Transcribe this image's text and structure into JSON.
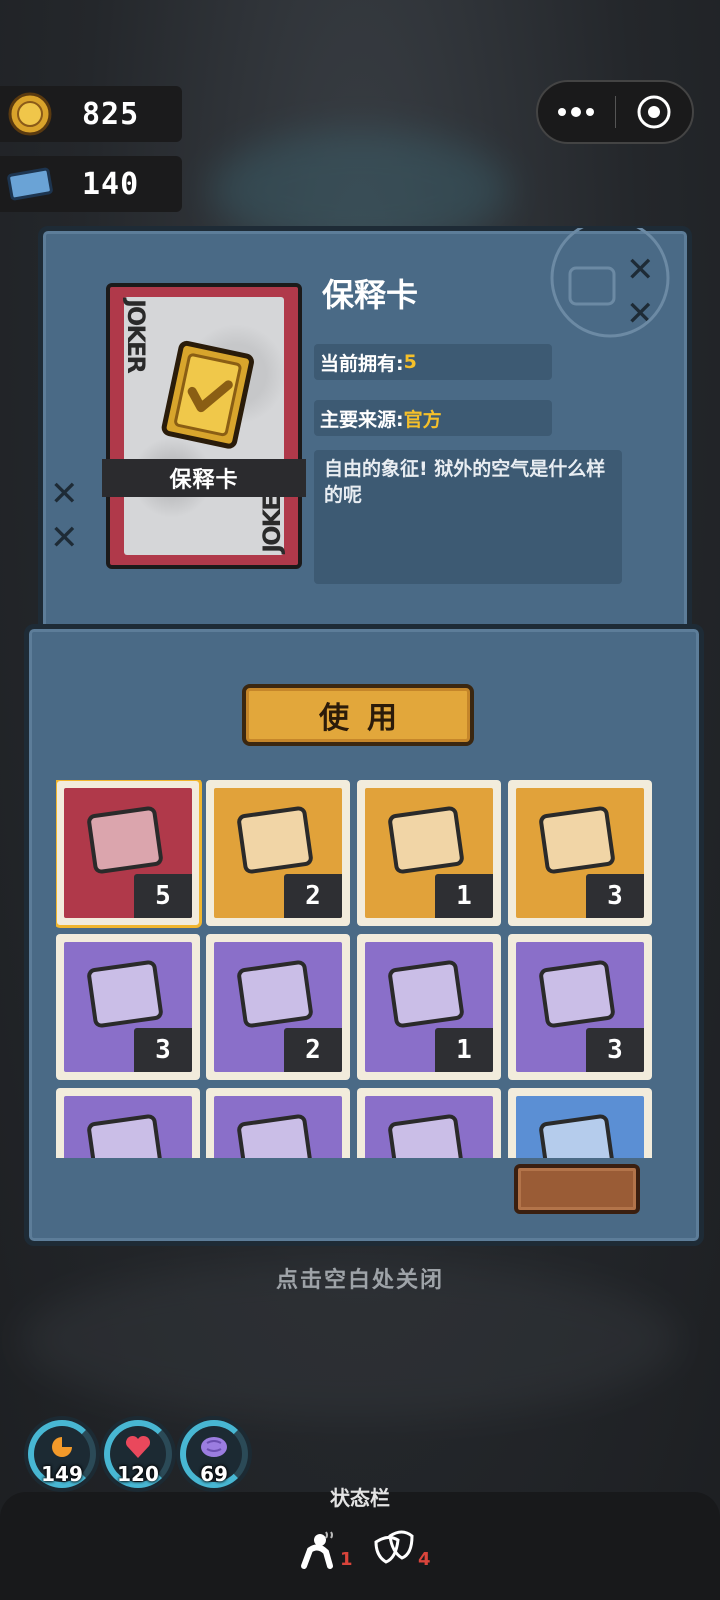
{
  "currency": {
    "coins": "825",
    "tickets": "140",
    "coin_icon": "gold-coin-icon",
    "ticket_icon": "blue-ticket-icon"
  },
  "capsule": {
    "more_icon": "more-dots-icon",
    "close_icon": "target-circle-icon"
  },
  "detail": {
    "title": "保释卡",
    "card_label": "保释卡",
    "card_corner_text": "JOKER",
    "owned_label": "当前拥有:",
    "owned_value": "5",
    "source_label": "主要来源:",
    "source_value": "官方",
    "description": "自由的象征! 狱外的空气是什么样的呢"
  },
  "use_button": {
    "label": "使用"
  },
  "items": [
    {
      "name": "bail-card",
      "count": "5",
      "bg": "#b0394a",
      "selected": true
    },
    {
      "name": "paw-map",
      "count": "2",
      "bg": "#e1a23a"
    },
    {
      "name": "film-reel",
      "count": "1",
      "bg": "#e1a23a"
    },
    {
      "name": "medical-card",
      "count": "3",
      "bg": "#e1a23a"
    },
    {
      "name": "blue-ticket",
      "count": "3",
      "bg": "#8a6fc9"
    },
    {
      "name": "id-card",
      "count": "2",
      "bg": "#8a6fc9"
    },
    {
      "name": "first-aid-kit",
      "count": "1",
      "bg": "#8a6fc9"
    },
    {
      "name": "green-book",
      "count": "3",
      "bg": "#8a6fc9"
    },
    {
      "name": "item-9",
      "count": "",
      "bg": "#8a6fc9"
    },
    {
      "name": "item-10",
      "count": "",
      "bg": "#8a6fc9"
    },
    {
      "name": "item-11",
      "count": "",
      "bg": "#8a6fc9"
    },
    {
      "name": "item-12",
      "count": "",
      "bg": "#5b8fd4"
    }
  ],
  "hint": "点击空白处关闭",
  "stats": [
    {
      "name": "hunger",
      "value": "149",
      "icon": "food-icon"
    },
    {
      "name": "health",
      "value": "120",
      "icon": "heart-icon"
    },
    {
      "name": "mind",
      "value": "69",
      "icon": "brain-icon"
    }
  ],
  "status_bar": {
    "title": "状态栏",
    "effects": [
      {
        "icon": "tired-person-icon",
        "count": "1"
      },
      {
        "icon": "masks-icon",
        "count": "4"
      }
    ]
  }
}
